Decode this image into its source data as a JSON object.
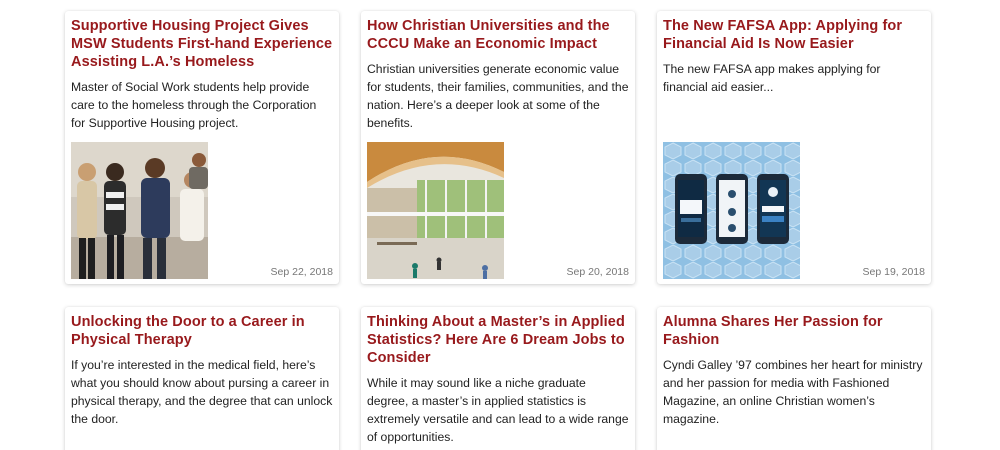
{
  "cards": [
    {
      "title": "Supportive Housing Project Gives MSW Students First-hand Experience Assisting L.A.’s Homeless",
      "excerpt": "Master of Social Work students help provide care to the homeless through the Corporation for Supportive Housing project.",
      "date": "Sep 22, 2018",
      "image": "group-of-students-photo"
    },
    {
      "title": "How Christian Universities and the CCCU Make an Economic Impact",
      "excerpt": "Christian universities generate economic value for students, their families, communities, and the nation. Here’s a deeper look at some of the benefits.",
      "date": "Sep 20, 2018",
      "image": "campus-atrium-photo"
    },
    {
      "title": "The New FAFSA App: Applying for Financial Aid Is Now Easier",
      "excerpt": "The new FAFSA app makes applying for financial aid easier...",
      "date": "Sep 19, 2018",
      "image": "fafsa-app-phones-illustration"
    },
    {
      "title": "Unlocking the Door to a Career in Physical Therapy",
      "excerpt": "If you’re interested in the medical field, here’s what you should know about pursing a career in physical therapy, and the degree that can unlock the door."
    },
    {
      "title": "Thinking About a Master’s in Applied Statistics? Here Are 6 Dream Jobs to Consider",
      "excerpt": "While it may sound like a niche graduate degree, a master’s in applied statistics is extremely versatile and can lead to a wide range of opportunities."
    },
    {
      "title": "Alumna Shares Her Passion for Fashion",
      "excerpt": "Cyndi Galley ’97 combines her heart for ministry and her passion for media with Fashioned Magazine, an online Christian women’s magazine."
    }
  ],
  "colors": {
    "title": "#98191c",
    "date": "#777777",
    "body_text": "#222222"
  }
}
